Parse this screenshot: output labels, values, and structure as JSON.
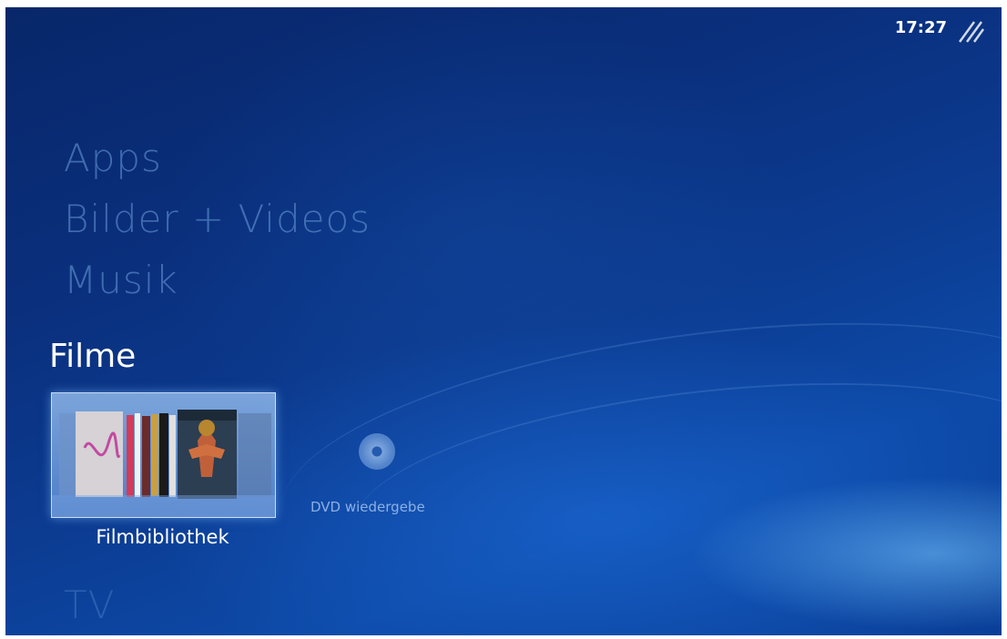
{
  "clock": {
    "time": "17:27"
  },
  "menu": {
    "categories_above": [
      {
        "label": "Apps"
      },
      {
        "label": "Bilder + Videos"
      },
      {
        "label": "Musik"
      }
    ],
    "active_category": {
      "label": "Filme"
    },
    "category_below": {
      "label": "TV"
    }
  },
  "strip": {
    "items": [
      {
        "label": "Filmbibliothek",
        "icon": "movie-library-icon",
        "selected": true
      },
      {
        "label": "DVD wiedergebe",
        "icon": "disc-icon",
        "selected": false
      }
    ]
  },
  "colors": {
    "background": "#0b3a8e",
    "active_text": "#ffffff",
    "inactive_text": "#6ea0dc"
  }
}
